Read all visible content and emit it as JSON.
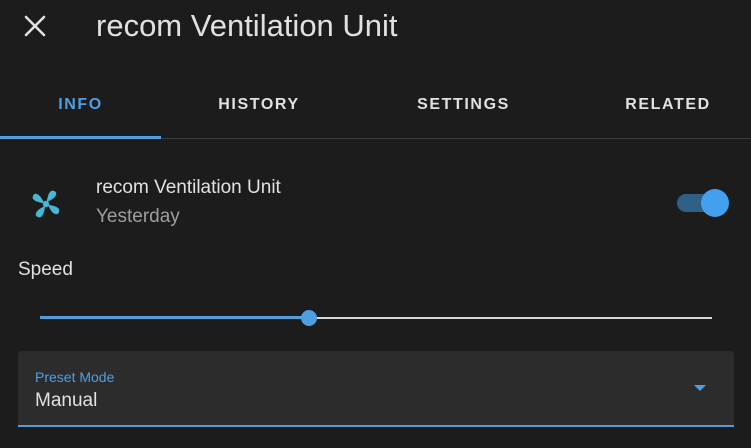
{
  "dialog": {
    "title": "recom Ventilation Unit",
    "close_icon": "close-icon"
  },
  "tabs": [
    {
      "label": "INFO",
      "active": true
    },
    {
      "label": "HISTORY",
      "active": false
    },
    {
      "label": "SETTINGS",
      "active": false
    },
    {
      "label": "RELATED",
      "active": false
    }
  ],
  "entity": {
    "icon": "fan-icon",
    "name": "recom Ventilation Unit",
    "last_changed": "Yesterday",
    "state_on": true
  },
  "speed": {
    "label": "Speed",
    "value_fraction": 0.4
  },
  "preset": {
    "label": "Preset Mode",
    "value": "Manual"
  },
  "colors": {
    "accent": "#4f9fe0",
    "fan_icon": "#44b8d4",
    "background": "#1c1c1c"
  }
}
